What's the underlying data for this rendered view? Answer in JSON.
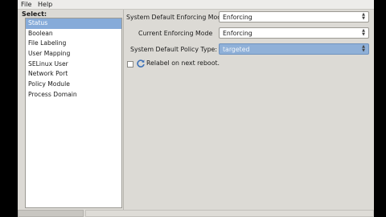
{
  "menubar": {
    "file": "File",
    "help": "Help"
  },
  "sidebar": {
    "label": "Select:",
    "items": [
      "Status",
      "Boolean",
      "File Labeling",
      "User Mapping",
      "SELinux User",
      "Network Port",
      "Policy Module",
      "Process Domain"
    ],
    "selected": "Status"
  },
  "status": {
    "default_mode_label": "System Default Enforcing Mode",
    "default_mode_value": "Enforcing",
    "current_mode_label": "Current Enforcing Mode",
    "current_mode_value": "Enforcing",
    "policy_type_label": "System Default Policy Type:",
    "policy_type_value": "targeted",
    "relabel_label": "Relabel on next reboot.",
    "relabel_checked": false
  },
  "colors": {
    "selection": "#86abd9",
    "active_combo": "#8fb0d8",
    "window_bg": "#dcdad5"
  }
}
